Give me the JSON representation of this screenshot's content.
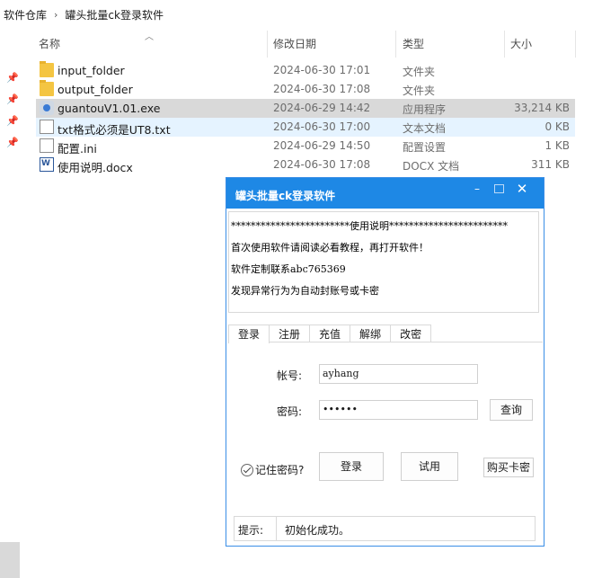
{
  "breadcrumb": [
    "软件仓库",
    "罐头批量ck登录软件"
  ],
  "columns": {
    "name": "名称",
    "date": "修改日期",
    "type": "类型",
    "size": "大小"
  },
  "files": [
    {
      "name": "input_folder",
      "date": "2024-06-30 17:01",
      "type": "文件夹",
      "size": "",
      "icon": "folder-icon"
    },
    {
      "name": "output_folder",
      "date": "2024-06-30 17:08",
      "type": "文件夹",
      "size": "",
      "icon": "folder-icon"
    },
    {
      "name": "guantouV1.01.exe",
      "date": "2024-06-29 14:42",
      "type": "应用程序",
      "size": "33,214 KB",
      "icon": "exe-icon"
    },
    {
      "name": "txt格式必须是UT8.txt",
      "date": "2024-06-30 17:00",
      "type": "文本文档",
      "size": "0 KB",
      "icon": "text-file-icon"
    },
    {
      "name": "配置.ini",
      "date": "2024-06-29 14:50",
      "type": "配置设置",
      "size": "1 KB",
      "icon": "ini-file-icon"
    },
    {
      "name": "使用说明.docx",
      "date": "2024-06-30 17:08",
      "type": "DOCX 文档",
      "size": "311 KB",
      "icon": "docx-file-icon"
    }
  ],
  "dialog": {
    "title": "罐头批量ck登录软件",
    "notice_lines": [
      "************************使用说明************************",
      "首次使用软件请阅读必看教程，再打开软件！",
      "软件定制联系abc765369",
      "发现异常行为为自动封账号或卡密"
    ],
    "tabs": [
      "登录",
      "注册",
      "充值",
      "解绑",
      "改密"
    ],
    "account_label": "帐号:",
    "account_value": "ayhang",
    "password_label": "密码:",
    "password_value": "••••••",
    "query_button": "查询",
    "remember_label": "记住密码?",
    "login_button": "登录",
    "trial_button": "试用",
    "buy_button": "购买卡密",
    "status_label": "提示:",
    "status_text": "初始化成功。"
  },
  "colors": {
    "titlebar": "#1e88e5",
    "selected_row": "#d9d9d9",
    "hover_row": "#e5f3ff"
  }
}
